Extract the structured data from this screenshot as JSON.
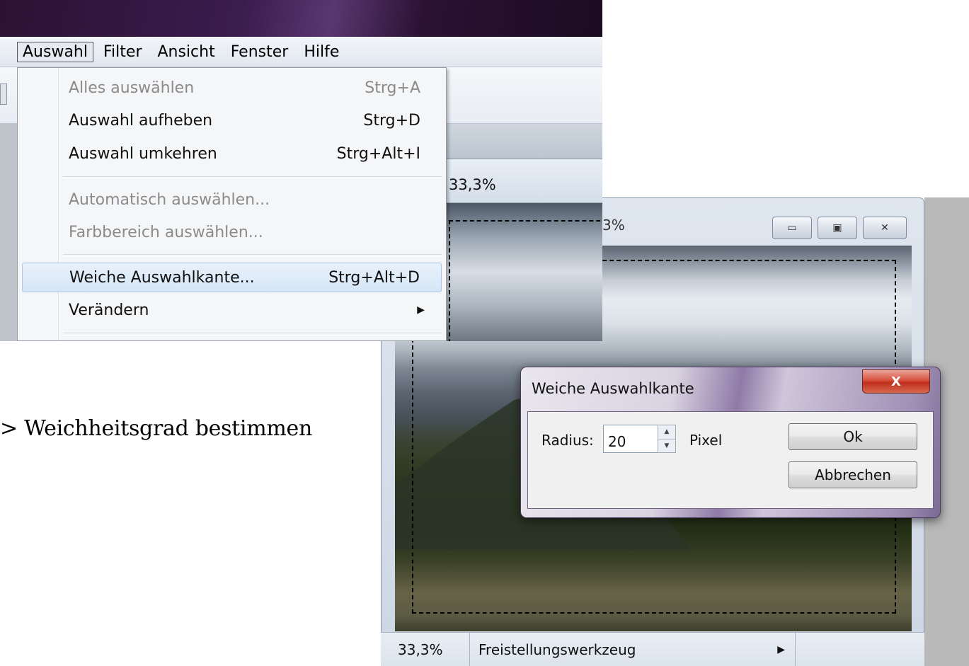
{
  "caption": "> Weichheitsgrad bestimmen",
  "menubar": {
    "items": [
      {
        "label": "Auswahl",
        "open": true
      },
      {
        "label": "Filter"
      },
      {
        "label": "Ansicht"
      },
      {
        "label": "Fenster"
      },
      {
        "label": "Hilfe"
      }
    ]
  },
  "menu": {
    "items": [
      {
        "label": "Alles auswählen",
        "shortcut": "Strg+A",
        "disabled": true
      },
      {
        "label": "Auswahl aufheben",
        "shortcut": "Strg+D"
      },
      {
        "label": "Auswahl umkehren",
        "shortcut": "Strg+Alt+I"
      },
      {
        "label": "Automatisch auswählen...",
        "disabled": true
      },
      {
        "label": "Farbbereich auswählen...",
        "disabled": true
      },
      {
        "label": "Weiche Auswahlkante...",
        "shortcut": "Strg+Alt+D",
        "highlighted": true
      },
      {
        "label": "Verändern",
        "submenu": true
      }
    ]
  },
  "doc_tab": {
    "zoom": "33,3%"
  },
  "image_window": {
    "title_fragment": "3%",
    "buttons": {
      "minimize": "▭",
      "maximize": "▣",
      "close": "✕"
    }
  },
  "status_bar": {
    "zoom": "33,3%",
    "tool": "Freistellungswerkzeug",
    "arrow": "▶"
  },
  "dialog": {
    "title": "Weiche Auswahlkante",
    "close_glyph": "X",
    "radius_label": "Radius:",
    "radius_value": "20",
    "unit_label": "Pixel",
    "ok_label": "Ok",
    "cancel_label": "Abbrechen",
    "spinner_up": "▲",
    "spinner_down": "▼"
  },
  "colors": {
    "titlebar": "#3b1c4e",
    "menu_highlight": "#d6e6f7",
    "dialog_close": "#d8503d"
  }
}
